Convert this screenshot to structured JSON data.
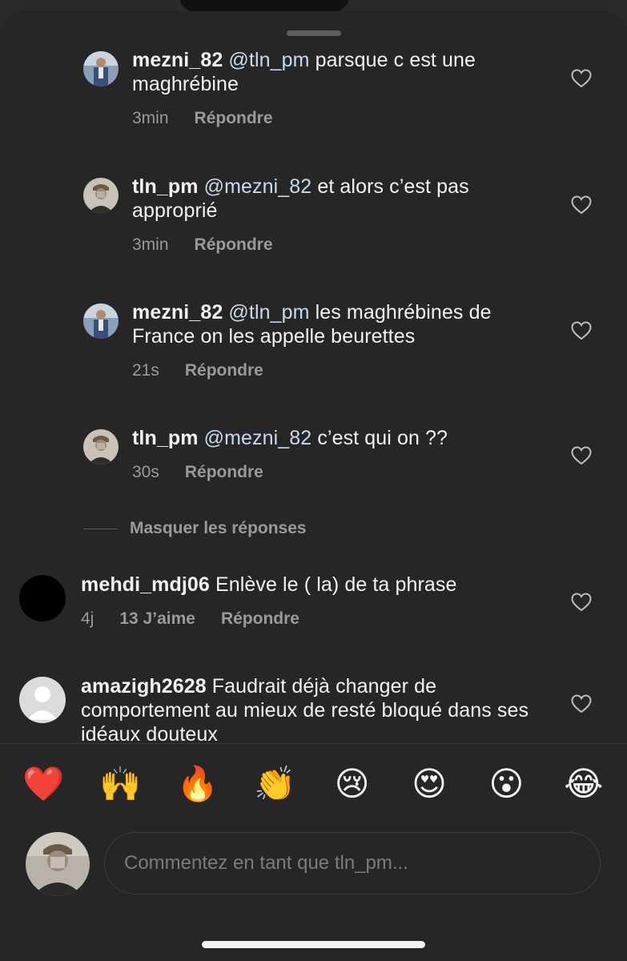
{
  "comments": [
    {
      "user": "mezni_82",
      "mention": "@tln_pm",
      "text": "parsque c est une maghrébine",
      "time": "3min",
      "likes": "",
      "reply": "Répondre",
      "avatar": "avatar-suit"
    },
    {
      "user": "tln_pm",
      "mention": "@mezni_82",
      "text": "et alors c’est pas approprié",
      "time": "3min",
      "likes": "",
      "reply": "Répondre",
      "avatar": "avatar-cap"
    },
    {
      "user": "mezni_82",
      "mention": "@tln_pm",
      "text": "les maghrébines de France on les appelle beurettes",
      "time": "21s",
      "likes": "",
      "reply": "Répondre",
      "avatar": "avatar-suit"
    },
    {
      "user": "tln_pm",
      "mention": "@mezni_82",
      "text": "c’est qui on ??",
      "time": "30s",
      "likes": "",
      "reply": "Répondre",
      "avatar": "avatar-cap"
    },
    {
      "user": "mehdi_mdj06",
      "mention": "",
      "text": "Enlève le ( la) de ta phrase",
      "time": "4j",
      "likes": "13 J’aime",
      "reply": "Répondre",
      "avatar": "avatar-black"
    },
    {
      "user": "amazigh2628",
      "mention": "",
      "text": "Faudrait déjà changer de comportement au mieux de resté bloqué dans ses idéaux douteux",
      "time": "",
      "likes": "",
      "reply": "",
      "avatar": "avatar-default"
    }
  ],
  "hide_replies_label": "Masquer les réponses",
  "emoji_bar": [
    "❤️",
    "🙌",
    "🔥",
    "👏",
    "😢",
    "😍",
    "😮",
    "😂"
  ],
  "compose": {
    "placeholder": "Commentez en tant que tln_pm..."
  },
  "colors": {
    "background": "#262626",
    "mention": "#c9d9ee",
    "muted": "#9a9a9a"
  }
}
